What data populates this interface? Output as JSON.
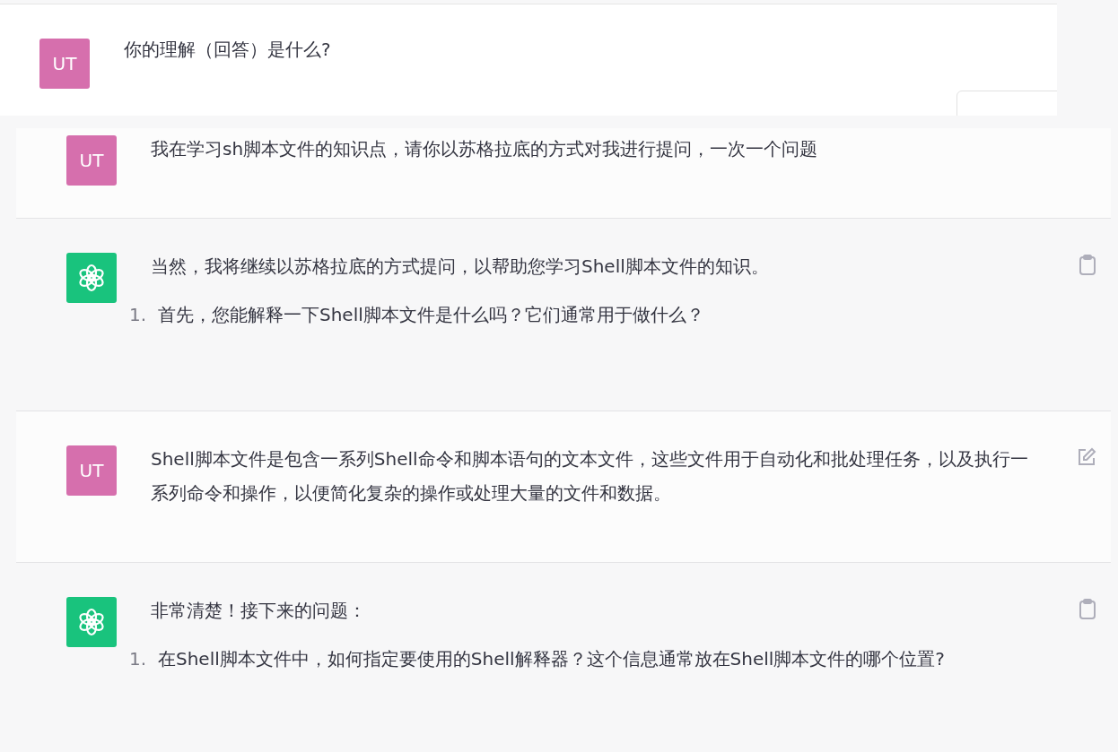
{
  "top_message": {
    "avatar": "UT",
    "text": "你的理解（回答）是什么?"
  },
  "messages": [
    {
      "kind": "user",
      "avatar": "UT",
      "text": "我在学习sh脚本文件的知识点，请你以苏格拉底的方式对我进行提问，一次一个问题"
    },
    {
      "kind": "assistant",
      "text": "当然，我将继续以苏格拉底的方式提问，以帮助您学习Shell脚本文件的知识。",
      "items": [
        {
          "number": "1.",
          "text": "首先，您能解释一下Shell脚本文件是什么吗？它们通常用于做什么？"
        }
      ],
      "action": {
        "kind": "copy"
      }
    },
    {
      "kind": "user",
      "avatar": "UT",
      "text": "Shell脚本文件是包含一系列Shell命令和脚本语句的文本文件，这些文件用于自动化和批处理任务，以及执行一系列命令和操作，以便简化复杂的操作或处理大量的文件和数据。",
      "action": {
        "kind": "edit"
      }
    },
    {
      "kind": "assistant",
      "text": "非常清楚！接下来的问题：",
      "items": [
        {
          "number": "1.",
          "text": "在Shell脚本文件中，如何指定要使用的Shell解释器？这个信息通常放在Shell脚本文件的哪个位置?"
        }
      ],
      "action": {
        "kind": "copy"
      }
    }
  ]
}
